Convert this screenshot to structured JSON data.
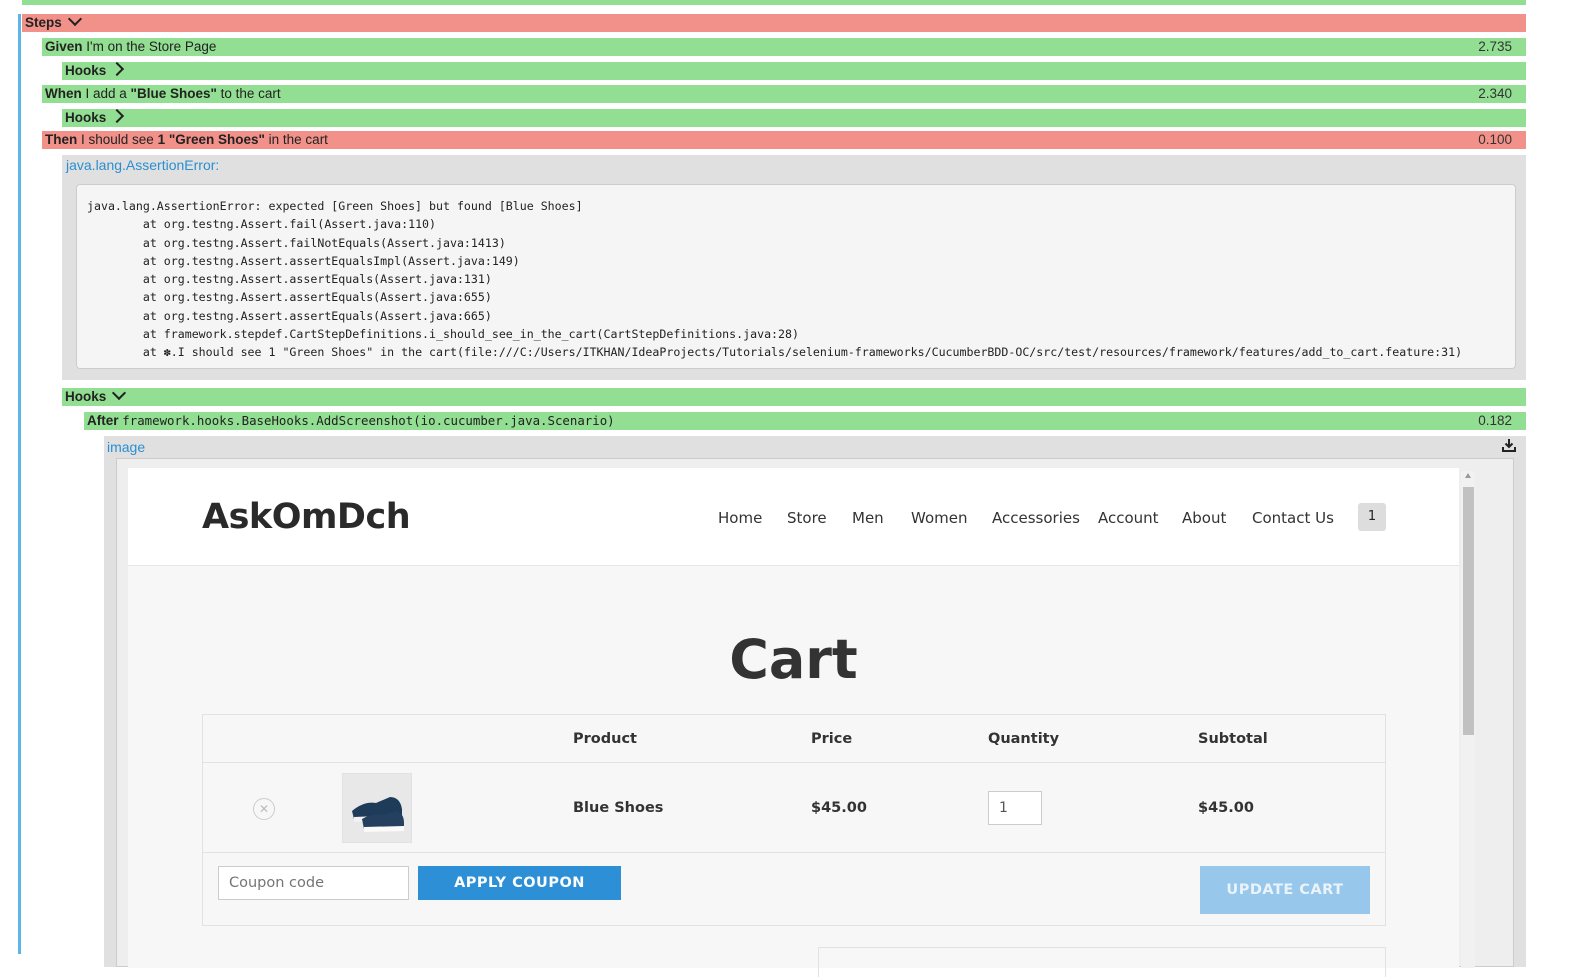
{
  "steps_header": "Steps",
  "given": {
    "keyword": "Given",
    "text": " I'm on the Store Page",
    "duration": "2.735"
  },
  "hooks_label": "Hooks",
  "when": {
    "keyword": "When",
    "text_pre": " I add a ",
    "arg": "\"Blue Shoes\"",
    "text_post": " to the cart",
    "duration": "2.340"
  },
  "then": {
    "keyword": "Then",
    "text_pre": " I should see ",
    "arg": "1 \"Green Shoes\"",
    "text_post": " in the cart",
    "duration": "0.100"
  },
  "error_link": "java.lang.AssertionError:",
  "stacktrace": "java.lang.AssertionError: expected [Green Shoes] but found [Blue Shoes]\n\tat org.testng.Assert.fail(Assert.java:110)\n\tat org.testng.Assert.failNotEquals(Assert.java:1413)\n\tat org.testng.Assert.assertEqualsImpl(Assert.java:149)\n\tat org.testng.Assert.assertEquals(Assert.java:131)\n\tat org.testng.Assert.assertEquals(Assert.java:655)\n\tat org.testng.Assert.assertEquals(Assert.java:665)\n\tat framework.stepdef.CartStepDefinitions.i_should_see_in_the_cart(CartStepDefinitions.java:28)\n\tat ✽.I should see 1 \"Green Shoes\" in the cart(file:///C:/Users/ITKHAN/IdeaProjects/Tutorials/selenium-frameworks/CucumberBDD-OC/src/test/resources/framework/features/add_to_cart.feature:31)",
  "after": {
    "keyword": "After",
    "method": "framework.hooks.BaseHooks.AddScreenshot(io.cucumber.java.Scenario)",
    "duration": "0.182"
  },
  "image_link": "image",
  "screenshot": {
    "logo": "AskOmDch",
    "nav": [
      "Home",
      "Store",
      "Men",
      "Women",
      "Accessories",
      "Account",
      "About",
      "Contact Us"
    ],
    "cart_count": "1",
    "page_title": "Cart",
    "columns": [
      "Product",
      "Price",
      "Quantity",
      "Subtotal"
    ],
    "row": {
      "product": "Blue Shoes",
      "price": "$45.00",
      "quantity": "1",
      "subtotal": "$45.00"
    },
    "coupon_placeholder": "Coupon code",
    "apply_coupon": "APPLY COUPON",
    "update_cart": "UPDATE CART"
  }
}
